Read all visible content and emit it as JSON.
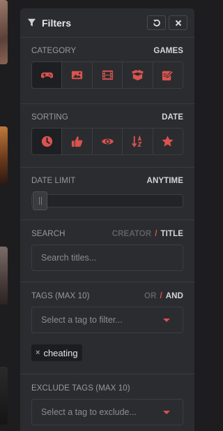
{
  "header": {
    "title": "Filters"
  },
  "category": {
    "label": "CATEGORY",
    "value": "GAMES",
    "options": [
      {
        "icon": "gamepad-icon",
        "active": true
      },
      {
        "icon": "image-icon",
        "active": false
      },
      {
        "icon": "film-icon",
        "active": false
      },
      {
        "icon": "box-icon",
        "active": false
      },
      {
        "icon": "edit-icon",
        "active": false
      }
    ]
  },
  "sorting": {
    "label": "SORTING",
    "value": "DATE",
    "options": [
      {
        "icon": "clock-icon",
        "active": true
      },
      {
        "icon": "thumbs-up-icon",
        "active": false
      },
      {
        "icon": "eye-icon",
        "active": false
      },
      {
        "icon": "sort-alpha-icon",
        "active": false
      },
      {
        "icon": "star-icon",
        "active": false
      }
    ]
  },
  "date_limit": {
    "label": "DATE LIMIT",
    "value": "ANYTIME",
    "slider_position": 0
  },
  "search": {
    "label": "SEARCH",
    "mode_creator": "CREATOR",
    "mode_title": "TITLE",
    "separator": "/",
    "placeholder": "Search titles..."
  },
  "tags": {
    "label": "TAGS (MAX 10)",
    "mode_or": "OR",
    "mode_and": "AND",
    "separator": "/",
    "placeholder": "Select a tag to filter...",
    "selected": [
      {
        "name": "cheating",
        "remove": "×"
      }
    ]
  },
  "exclude_tags": {
    "label": "EXCLUDE TAGS (MAX 10)",
    "placeholder": "Select a tag to exclude..."
  },
  "colors": {
    "accent": "#d9534f",
    "panel": "#2b2c2f",
    "background": "#1d1d20"
  }
}
